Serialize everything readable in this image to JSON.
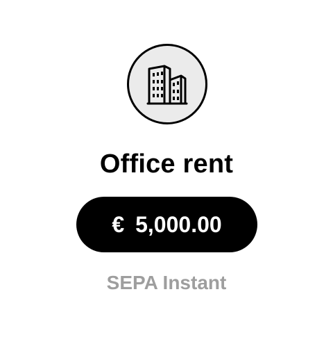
{
  "payee": {
    "icon": "office-building-icon",
    "title": "Office rent"
  },
  "amount": {
    "currency_symbol": "€",
    "value": "5,000.00"
  },
  "payment_method": "SEPA Instant",
  "colors": {
    "pill_background": "#000000",
    "pill_text": "#ffffff",
    "icon_circle_fill": "#ebebeb",
    "method_text": "#9e9e9e"
  }
}
